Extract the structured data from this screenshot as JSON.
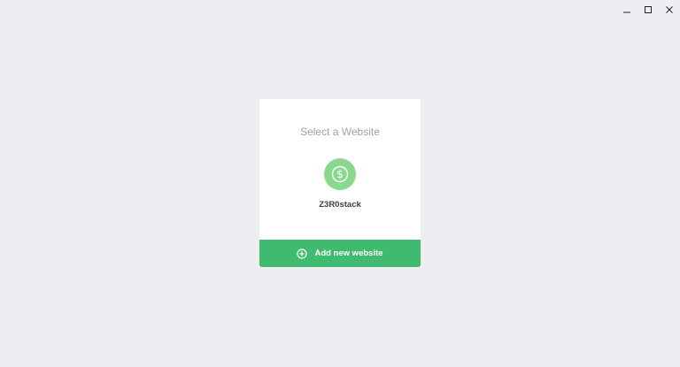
{
  "window": {
    "controls": {
      "minimize": "minimize-icon",
      "maximize": "maximize-icon",
      "close": "close-icon"
    }
  },
  "card": {
    "title": "Select a Website",
    "sites": [
      {
        "name": "Z3R0stack",
        "icon": "dollar-icon",
        "color": "#8ad88e"
      }
    ],
    "add_button": {
      "label": "Add new website",
      "icon": "plus-circle-icon",
      "color": "#3fba6f"
    }
  }
}
